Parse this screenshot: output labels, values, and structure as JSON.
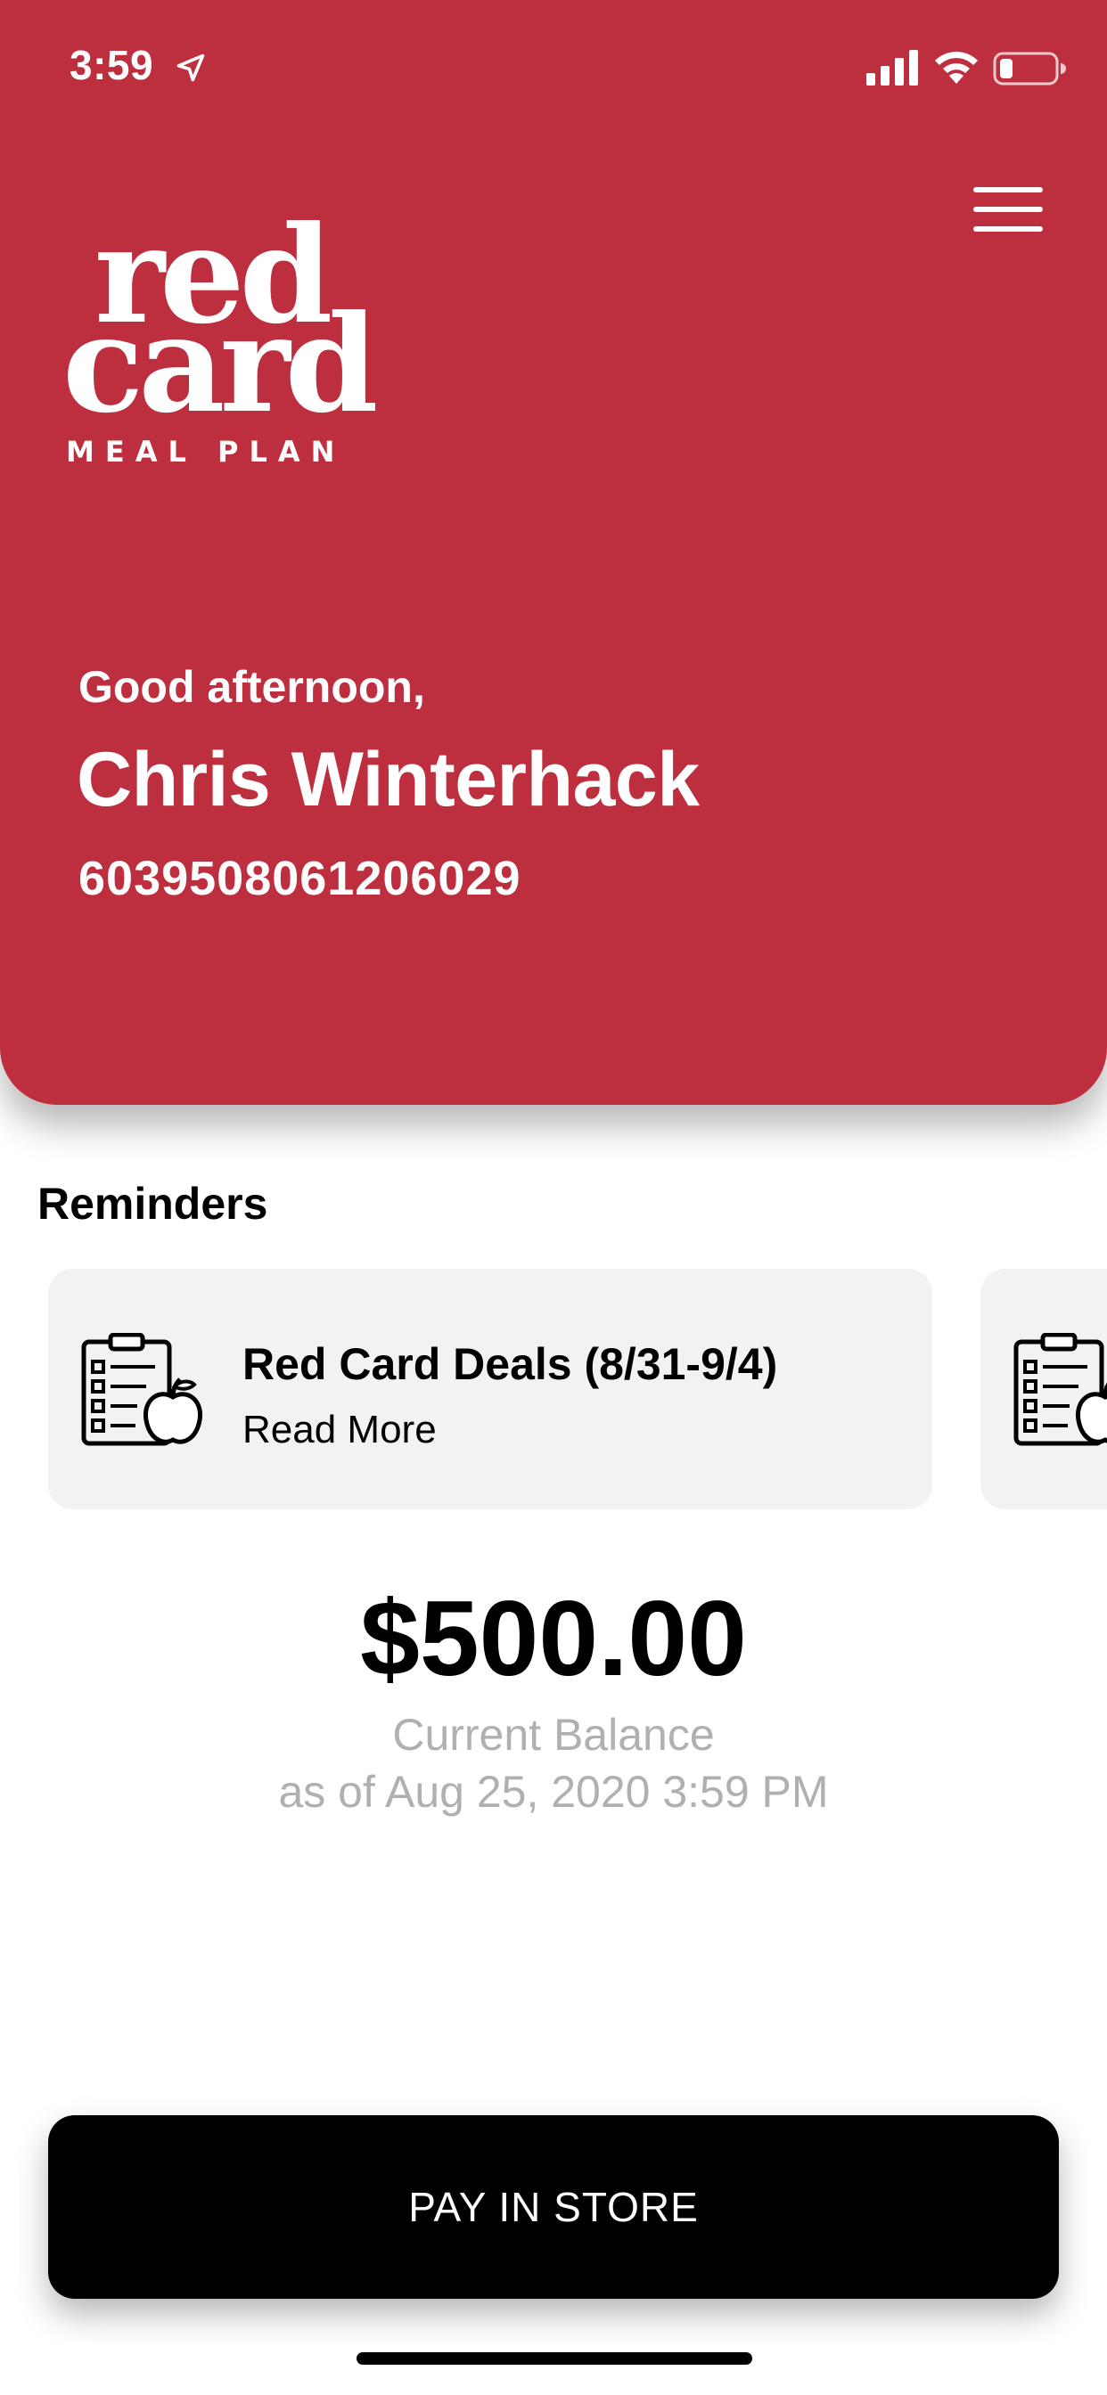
{
  "status_bar": {
    "time": "3:59",
    "icons": [
      "location-arrow-icon",
      "signal-icon",
      "wifi-icon",
      "battery-icon"
    ]
  },
  "header": {
    "background_color": "#bd2f3e",
    "menu_icon": "hamburger-menu-icon",
    "logo": {
      "line1": "red",
      "line2": "card",
      "subtitle": "MEAL PLAN"
    },
    "greeting": "Good afternoon,",
    "user_name": "Chris Winterhack",
    "card_number": "6039508061206029"
  },
  "reminders": {
    "title": "Reminders",
    "items": [
      {
        "icon": "clipboard-apple-icon",
        "title": "Red Card Deals (8/31-9/4)",
        "link": "Read More"
      },
      {
        "icon": "clipboard-apple-icon"
      }
    ]
  },
  "balance": {
    "amount": "$500.00",
    "label": "Current Balance",
    "as_of": "as of Aug 25, 2020 3:59 PM"
  },
  "actions": {
    "pay_button": "PAY IN STORE"
  }
}
